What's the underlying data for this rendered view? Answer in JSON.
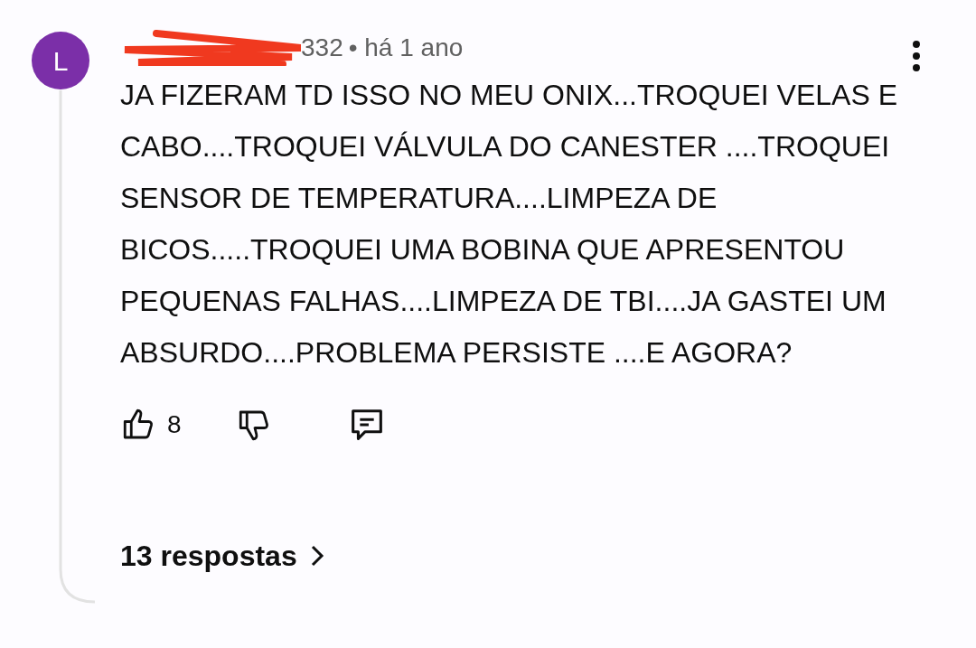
{
  "comment": {
    "avatar_letter": "L",
    "handle_visible": "332",
    "meta": "• há 1 ano",
    "text": "JA FIZERAM TD ISSO NO MEU ONIX...TROQUEI VELAS E CABO....TROQUEI VÁLVULA DO CANESTER ....TROQUEI SENSOR DE TEMPERATURA....LIMPEZA DE BICOS.....TROQUEI UMA BOBINA QUE APRESENTOU PEQUENAS FALHAS....LIMPEZA DE TBI....JA GASTEI UM ABSURDO....PROBLEMA PERSISTE ....E AGORA?",
    "likes": "8",
    "replies": "13 respostas"
  }
}
